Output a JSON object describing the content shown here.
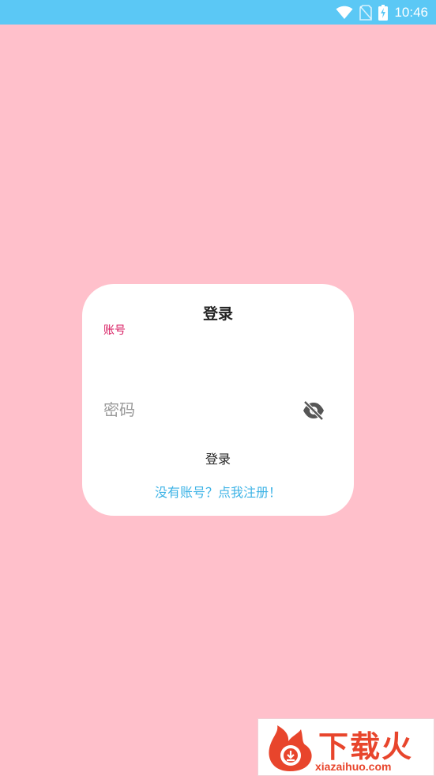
{
  "status_bar": {
    "time": "10:46",
    "icons": [
      "wifi-icon",
      "no-sim-icon",
      "battery-charging-icon"
    ]
  },
  "login": {
    "title": "登录",
    "account_label": "账号",
    "account_value": "",
    "password_placeholder": "密码",
    "password_toggle_icon": "eye-off-icon",
    "login_button": "登录",
    "register_link": "没有账号？点我注册！"
  },
  "watermark": {
    "cn": "下载火",
    "en": "xiazaihuo.com"
  },
  "colors": {
    "background": "#FFC0CB",
    "status_bar": "#5BC8F5",
    "card": "#FFFFFF",
    "accent_label": "#D81B60",
    "link": "#3DB3E6",
    "watermark": "#E8452C"
  }
}
